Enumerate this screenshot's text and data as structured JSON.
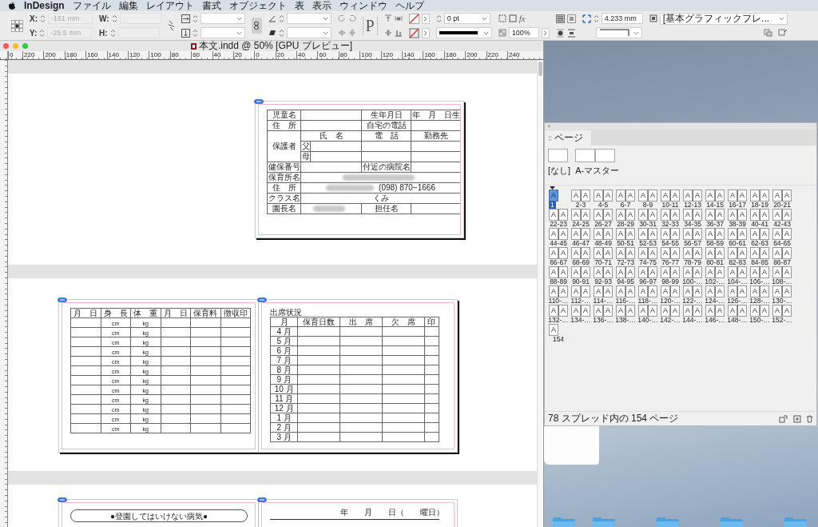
{
  "menu_bar": {
    "app": "InDesign",
    "items": [
      "ファイル",
      "編集",
      "レイアウト",
      "書式",
      "オブジェクト",
      "表",
      "表示",
      "ウィンドウ",
      "ヘルプ"
    ]
  },
  "control_panel": {
    "x_label": "X:",
    "x_value": "-161 mm",
    "y_label": "Y:",
    "y_value": "-25.5 mm",
    "w_label": "W:",
    "h_label": "H:",
    "fields_disabled": true,
    "container_glyph": "P",
    "stroke_weight": "0 pt",
    "effects_glyph": "fx",
    "opacity": "100%",
    "gap": "4.233 mm",
    "object_style": "[基本グラフィックフレ..."
  },
  "document": {
    "title": "本文.indd @ 50% [GPU プレビュー]",
    "ruler_labels": [
      "0",
      "220",
      "200",
      "180",
      "160",
      "140",
      "120",
      "100",
      "80",
      "60",
      "40",
      "20",
      "0",
      "20",
      "40",
      "60",
      "80",
      "100",
      "120",
      "140",
      "160",
      "180",
      "200",
      "220",
      "240"
    ],
    "child_record": {
      "name_label": "児童名",
      "birth_label": "生年月日",
      "birth_value": "年　月　日生",
      "address_label": "住　所",
      "home_phone_label": "自宅の電話",
      "guardian_label": "保護者",
      "name_col": "氏　名",
      "phone_col": "電　話",
      "work_col": "勤務先",
      "father": "父",
      "mother": "母",
      "insurance_label": "健保番号",
      "hospital_label": "付近の病院名",
      "nursery_label": "保育所名",
      "nursery_address_label": "住　所",
      "nursery_phone": "(098) 870−1666",
      "class_label": "クラス名",
      "class_value": "くみ",
      "principal_label": "園長名",
      "teacher_label": "担任名"
    },
    "growth_table": {
      "columns": [
        "月　日",
        "身　長",
        "体　重",
        "月　日",
        "保育料",
        "徴収印"
      ],
      "rows": [
        {
          "height_unit": "cm",
          "weight_unit": "kg"
        },
        {
          "height_unit": "cm",
          "weight_unit": "kg"
        },
        {
          "height_unit": "cm",
          "weight_unit": "kg"
        },
        {
          "height_unit": "cm",
          "weight_unit": "kg"
        },
        {
          "height_unit": "cm",
          "weight_unit": "kg"
        },
        {
          "height_unit": "cm",
          "weight_unit": "kg"
        },
        {
          "height_unit": "cm",
          "weight_unit": "kg"
        },
        {
          "height_unit": "cm",
          "weight_unit": "kg"
        },
        {
          "height_unit": "cm",
          "weight_unit": "kg"
        },
        {
          "height_unit": "cm",
          "weight_unit": "kg"
        },
        {
          "height_unit": "cm",
          "weight_unit": "kg"
        },
        {
          "height_unit": "cm",
          "weight_unit": "kg"
        }
      ]
    },
    "attendance_table": {
      "title": "出席状況",
      "columns": [
        "月",
        "保育日数",
        "出　席",
        "欠　席",
        "印"
      ],
      "months": [
        "4 月",
        "5 月",
        "6 月",
        "7 月",
        "8 月",
        "9 月",
        "10 月",
        "11 月",
        "12 月",
        "1 月",
        "2 月",
        "3 月"
      ]
    },
    "next_spread": {
      "notice_heading": "●登園してはいけない病気●",
      "date_line": "年　　月　　日（　　曜日）"
    }
  },
  "pages_panel": {
    "close_glyph": "×",
    "tab": "ページ",
    "masters": [
      {
        "label": "[なし]",
        "kind": "single"
      },
      {
        "label": "A-マスター",
        "kind": "spread"
      }
    ],
    "spreads": [
      {
        "label": "1",
        "pages": [
          "A"
        ],
        "selected": true
      },
      {
        "label": "2-3",
        "pages": [
          "A",
          "A"
        ],
        "selected": false
      },
      {
        "label": "4-5",
        "pages": [
          "A",
          "A"
        ],
        "selected": false
      },
      {
        "label": "6-7",
        "pages": [
          "A",
          "A"
        ],
        "selected": false
      },
      {
        "label": "8-9",
        "pages": [
          "A",
          "A"
        ],
        "selected": false
      },
      {
        "label": "10-11",
        "pages": [
          "A",
          "A"
        ],
        "selected": false
      },
      {
        "label": "12-13",
        "pages": [
          "A",
          "A"
        ],
        "selected": false
      },
      {
        "label": "14-15",
        "pages": [
          "A",
          "A"
        ],
        "selected": false
      },
      {
        "label": "16-17",
        "pages": [
          "A",
          "A"
        ],
        "selected": false
      },
      {
        "label": "18-19",
        "pages": [
          "A",
          "A"
        ],
        "selected": false
      },
      {
        "label": "20-21",
        "pages": [
          "A",
          "A"
        ],
        "selected": false
      },
      {
        "label": "22-23",
        "pages": [
          "A",
          "A"
        ],
        "selected": false
      },
      {
        "label": "24-25",
        "pages": [
          "A",
          "A"
        ],
        "selected": false
      },
      {
        "label": "26-27",
        "pages": [
          "A",
          "A"
        ],
        "selected": false
      },
      {
        "label": "28-29",
        "pages": [
          "A",
          "A"
        ],
        "selected": false
      },
      {
        "label": "30-31",
        "pages": [
          "A",
          "A"
        ],
        "selected": false
      },
      {
        "label": "32-33",
        "pages": [
          "A",
          "A"
        ],
        "selected": false
      },
      {
        "label": "34-35",
        "pages": [
          "A",
          "A"
        ],
        "selected": false
      },
      {
        "label": "36-37",
        "pages": [
          "A",
          "A"
        ],
        "selected": false
      },
      {
        "label": "38-39",
        "pages": [
          "A",
          "A"
        ],
        "selected": false
      },
      {
        "label": "40-41",
        "pages": [
          "A",
          "A"
        ],
        "selected": false
      },
      {
        "label": "42-43",
        "pages": [
          "A",
          "A"
        ],
        "selected": false
      },
      {
        "label": "44-45",
        "pages": [
          "A",
          "A"
        ],
        "selected": false
      },
      {
        "label": "46-47",
        "pages": [
          "A",
          "A"
        ],
        "selected": false
      },
      {
        "label": "48-49",
        "pages": [
          "A",
          "A"
        ],
        "selected": false
      },
      {
        "label": "50-51",
        "pages": [
          "A",
          "A"
        ],
        "selected": false
      },
      {
        "label": "52-53",
        "pages": [
          "A",
          "A"
        ],
        "selected": false
      },
      {
        "label": "54-55",
        "pages": [
          "A",
          "A"
        ],
        "selected": false
      },
      {
        "label": "56-57",
        "pages": [
          "A",
          "A"
        ],
        "selected": false
      },
      {
        "label": "58-59",
        "pages": [
          "A",
          "A"
        ],
        "selected": false
      },
      {
        "label": "60-61",
        "pages": [
          "A",
          "A"
        ],
        "selected": false
      },
      {
        "label": "62-63",
        "pages": [
          "A",
          "A"
        ],
        "selected": false
      },
      {
        "label": "64-65",
        "pages": [
          "A",
          "A"
        ],
        "selected": false
      },
      {
        "label": "66-67",
        "pages": [
          "A",
          "A"
        ],
        "selected": false
      },
      {
        "label": "68-69",
        "pages": [
          "A",
          "A"
        ],
        "selected": false
      },
      {
        "label": "70-71",
        "pages": [
          "A",
          "A"
        ],
        "selected": false
      },
      {
        "label": "72-73",
        "pages": [
          "A",
          "A"
        ],
        "selected": false
      },
      {
        "label": "74-75",
        "pages": [
          "A",
          "A"
        ],
        "selected": false
      },
      {
        "label": "76-77",
        "pages": [
          "A",
          "A"
        ],
        "selected": false
      },
      {
        "label": "78-79",
        "pages": [
          "A",
          "A"
        ],
        "selected": false
      },
      {
        "label": "80-81",
        "pages": [
          "A",
          "A"
        ],
        "selected": false
      },
      {
        "label": "82-83",
        "pages": [
          "A",
          "A"
        ],
        "selected": false
      },
      {
        "label": "84-85",
        "pages": [
          "A",
          "A"
        ],
        "selected": false
      },
      {
        "label": "86-87",
        "pages": [
          "A",
          "A"
        ],
        "selected": false
      },
      {
        "label": "88-89",
        "pages": [
          "A",
          "A"
        ],
        "selected": false
      },
      {
        "label": "90-91",
        "pages": [
          "A",
          "A"
        ],
        "selected": false
      },
      {
        "label": "92-93",
        "pages": [
          "A",
          "A"
        ],
        "selected": false
      },
      {
        "label": "94-95",
        "pages": [
          "A",
          "A"
        ],
        "selected": false
      },
      {
        "label": "96-97",
        "pages": [
          "A",
          "A"
        ],
        "selected": false
      },
      {
        "label": "98-99",
        "pages": [
          "A",
          "A"
        ],
        "selected": false
      },
      {
        "label": "100-…",
        "pages": [
          "A",
          "A"
        ],
        "selected": false
      },
      {
        "label": "102-…",
        "pages": [
          "A",
          "A"
        ],
        "selected": false
      },
      {
        "label": "104-…",
        "pages": [
          "A",
          "A"
        ],
        "selected": false
      },
      {
        "label": "106-…",
        "pages": [
          "A",
          "A"
        ],
        "selected": false
      },
      {
        "label": "108-…",
        "pages": [
          "A",
          "A"
        ],
        "selected": false
      },
      {
        "label": "110-…",
        "pages": [
          "A",
          "A"
        ],
        "selected": false
      },
      {
        "label": "112-…",
        "pages": [
          "A",
          "A"
        ],
        "selected": false
      },
      {
        "label": "114-…",
        "pages": [
          "A",
          "A"
        ],
        "selected": false
      },
      {
        "label": "116-…",
        "pages": [
          "A",
          "A"
        ],
        "selected": false
      },
      {
        "label": "118-…",
        "pages": [
          "A",
          "A"
        ],
        "selected": false
      },
      {
        "label": "120-…",
        "pages": [
          "A",
          "A"
        ],
        "selected": false
      },
      {
        "label": "122-…",
        "pages": [
          "A",
          "A"
        ],
        "selected": false
      },
      {
        "label": "124-…",
        "pages": [
          "A",
          "A"
        ],
        "selected": false
      },
      {
        "label": "126-…",
        "pages": [
          "A",
          "A"
        ],
        "selected": false
      },
      {
        "label": "128-…",
        "pages": [
          "A",
          "A"
        ],
        "selected": false
      },
      {
        "label": "130-…",
        "pages": [
          "A",
          "A"
        ],
        "selected": false
      },
      {
        "label": "132-…",
        "pages": [
          "A",
          "A"
        ],
        "selected": false
      },
      {
        "label": "134-…",
        "pages": [
          "A",
          "A"
        ],
        "selected": false
      },
      {
        "label": "136-…",
        "pages": [
          "A",
          "A"
        ],
        "selected": false
      },
      {
        "label": "138-…",
        "pages": [
          "A",
          "A"
        ],
        "selected": false
      },
      {
        "label": "140-…",
        "pages": [
          "A",
          "A"
        ],
        "selected": false
      },
      {
        "label": "142-…",
        "pages": [
          "A",
          "A"
        ],
        "selected": false
      },
      {
        "label": "144-…",
        "pages": [
          "A",
          "A"
        ],
        "selected": false
      },
      {
        "label": "146-…",
        "pages": [
          "A",
          "A"
        ],
        "selected": false
      },
      {
        "label": "148-…",
        "pages": [
          "A",
          "A"
        ],
        "selected": false
      },
      {
        "label": "150-…",
        "pages": [
          "A",
          "A"
        ],
        "selected": false
      },
      {
        "label": "152-…",
        "pages": [
          "A",
          "A"
        ],
        "selected": false
      },
      {
        "label": "154",
        "pages": [
          "A"
        ],
        "selected": false
      }
    ],
    "footer": "78 スプレッド内の 154 ページ"
  }
}
